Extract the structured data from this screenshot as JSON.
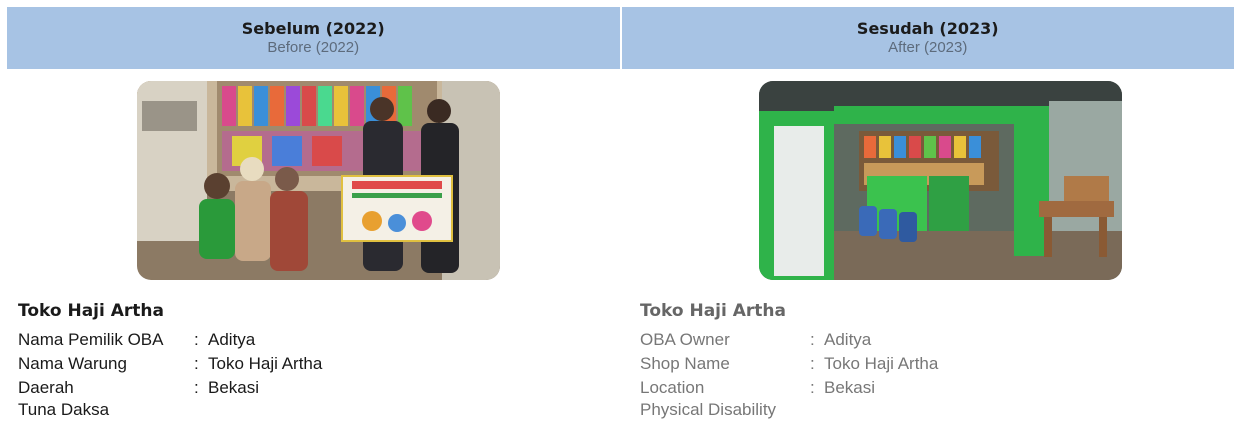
{
  "header": {
    "before": {
      "title": "Sebelum (2022)",
      "subtitle": "Before (2022)"
    },
    "after": {
      "title": "Sesudah (2023)",
      "subtitle": "After (2023)"
    }
  },
  "before": {
    "shop_title": "Toko Haji Artha",
    "rows": [
      {
        "label": "Nama Pemilik OBA",
        "value": "Aditya"
      },
      {
        "label": "Nama Warung",
        "value": "Toko Haji Artha"
      },
      {
        "label": "Daerah",
        "value": "Bekasi"
      }
    ],
    "extra": "Tuna Daksa"
  },
  "after": {
    "shop_title": "Toko Haji Artha",
    "rows": [
      {
        "label": "OBA Owner",
        "value": "Aditya"
      },
      {
        "label": "Shop Name",
        "value": "Toko Haji Artha"
      },
      {
        "label": "Location",
        "value": "Bekasi"
      }
    ],
    "extra": "Physical Disability"
  },
  "colors": {
    "header_bg": "#a7c3e4",
    "shop_green": "#2fb34a"
  },
  "colon": ":"
}
